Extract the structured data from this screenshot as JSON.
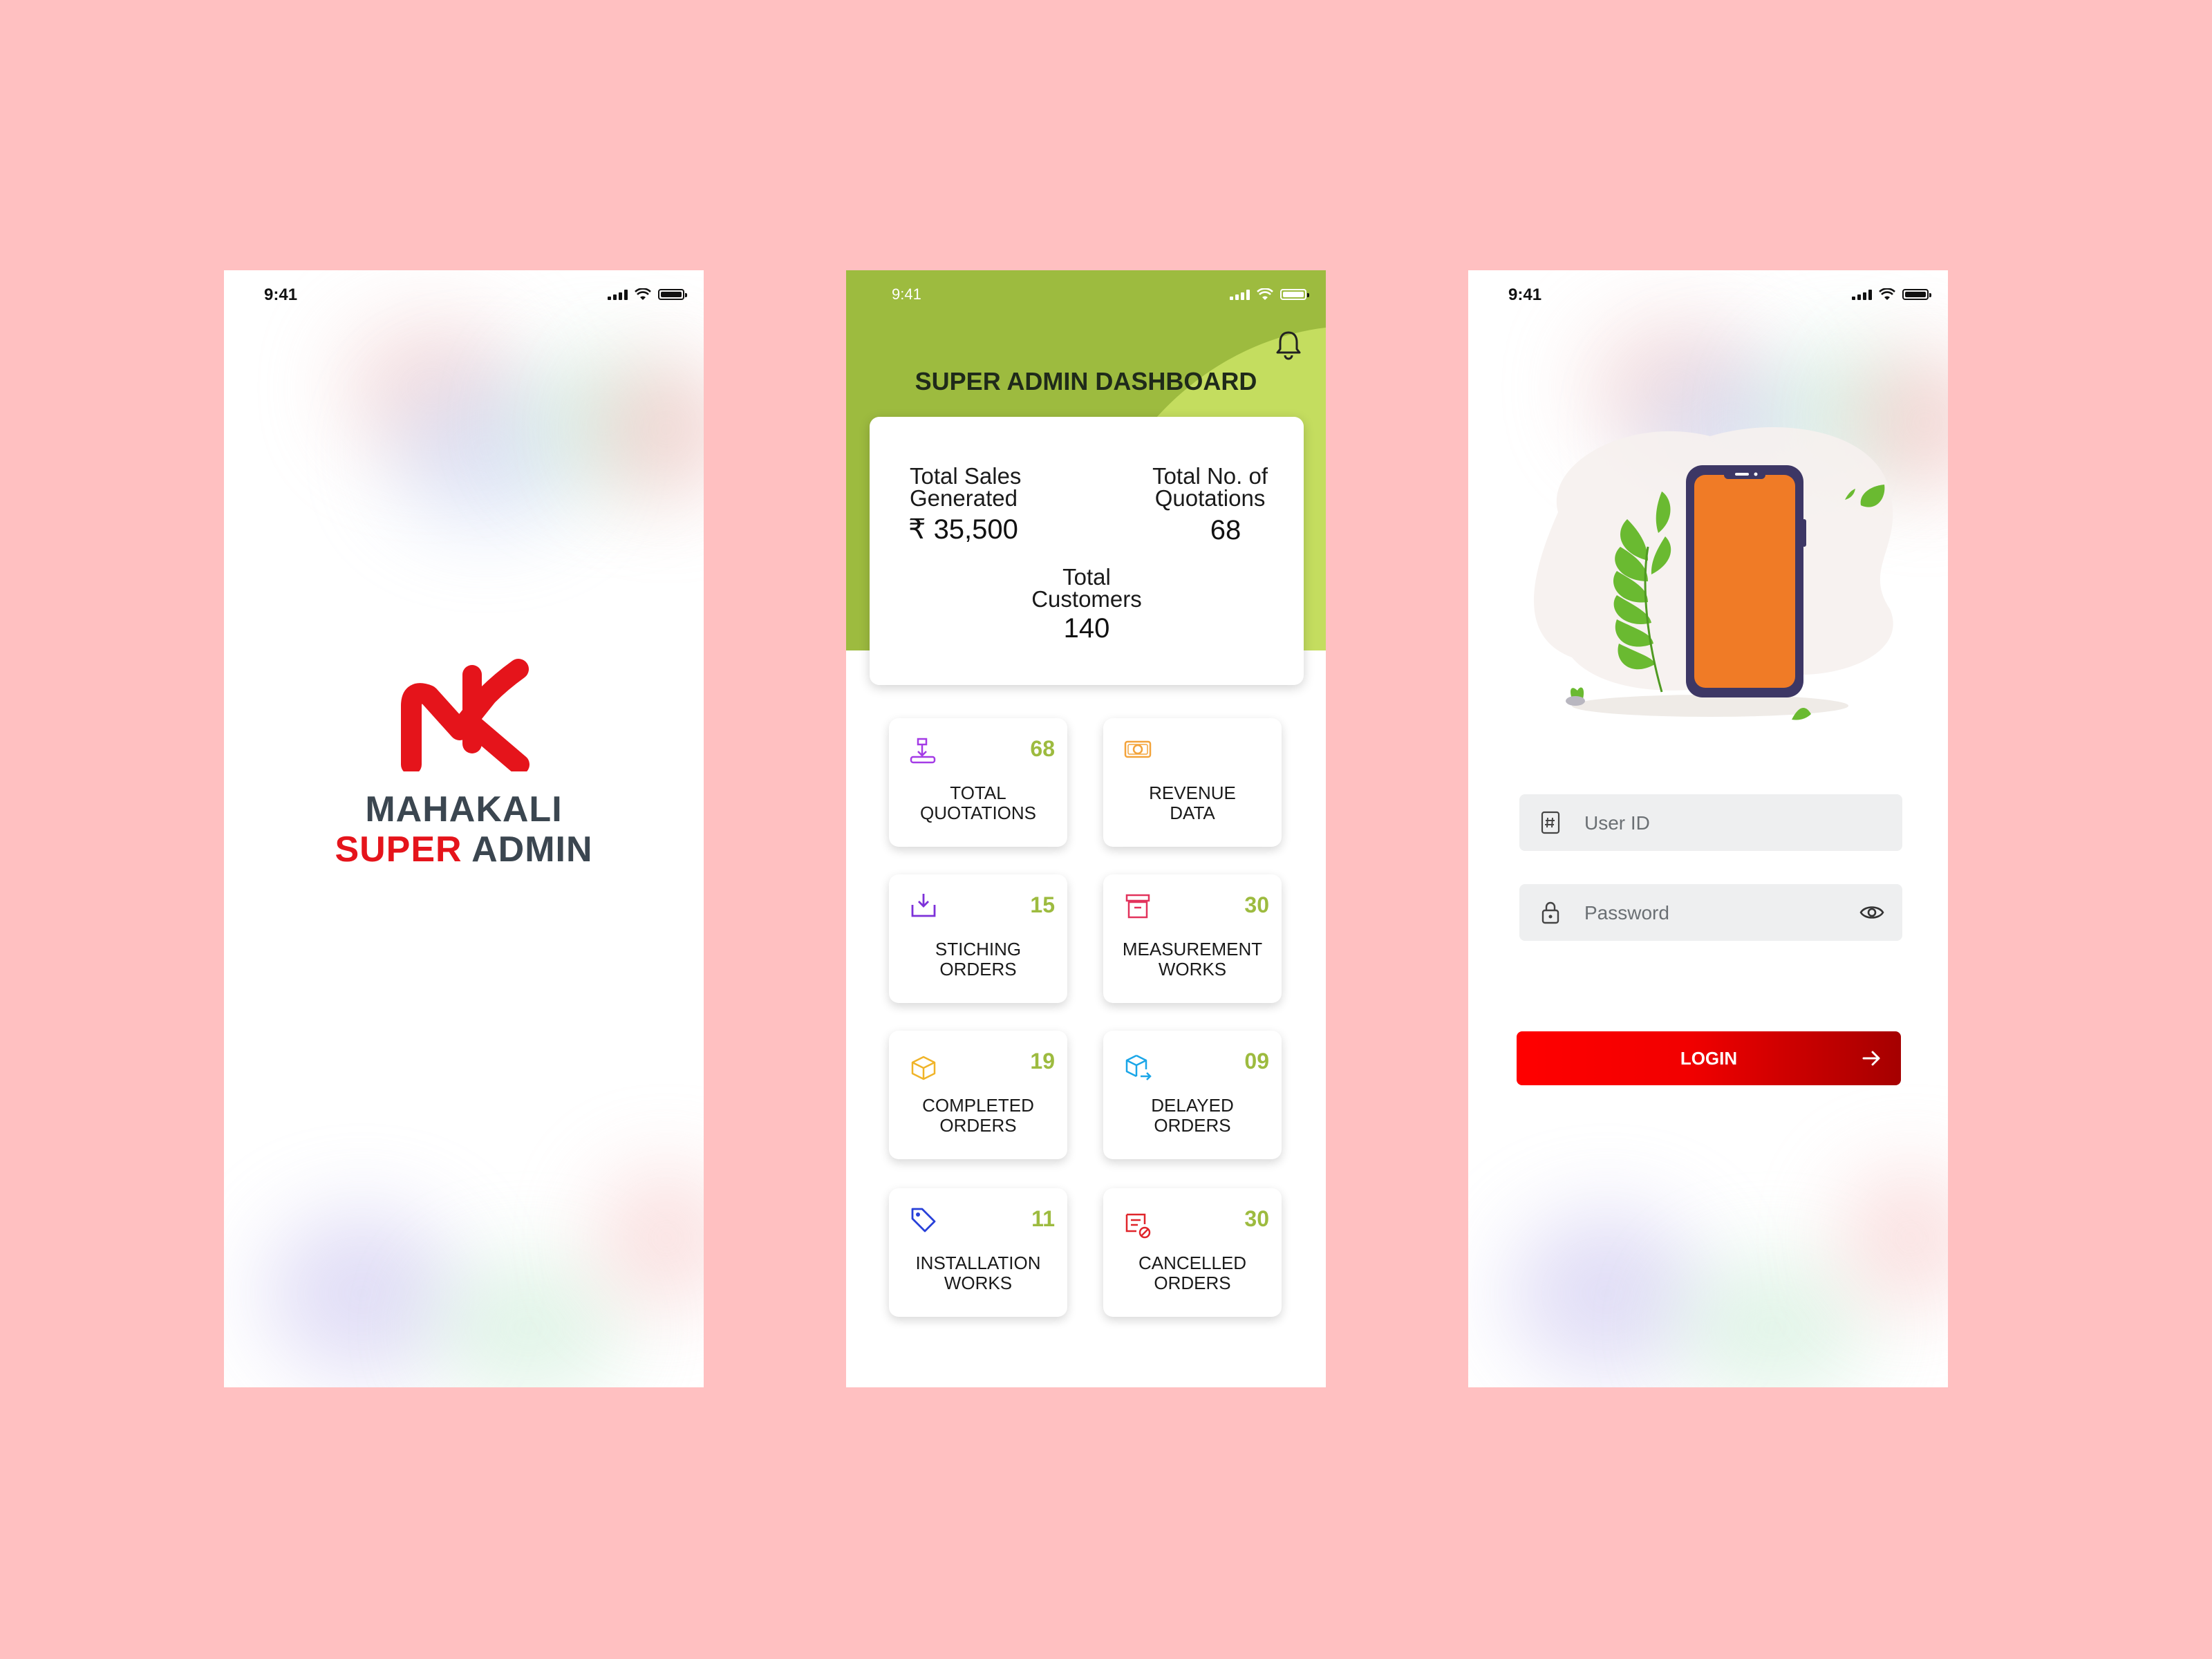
{
  "status_bar": {
    "time": "9:41"
  },
  "splash": {
    "brand_line1": "MAHAKALI",
    "brand_line2_red": "SUPER",
    "brand_line2_dark": "ADMIN"
  },
  "dashboard": {
    "title": "SUPER ADMIN DASHBOARD",
    "summary": {
      "sales_label_line1": "Total Sales",
      "sales_label_line2": "Generated",
      "sales_value": "₹ 35,500",
      "quotations_label_line1": "Total No. of",
      "quotations_label_line2": "Quotations",
      "quotations_value": "68",
      "customers_label_line1": "Total",
      "customers_label_line2": "Customers",
      "customers_value": "140"
    },
    "tiles": [
      {
        "line1": "TOTAL",
        "line2": "QUOTATIONS",
        "count": "68",
        "icon": "quotation-icon",
        "color": "#a43be6"
      },
      {
        "line1": "REVENUE",
        "line2": "DATA",
        "count": "",
        "icon": "money-icon",
        "color": "#f3a33a"
      },
      {
        "line1": "STICHING",
        "line2": "ORDERS",
        "count": "15",
        "icon": "download-box-icon",
        "color": "#7d31d9"
      },
      {
        "line1": "MEASUREMENT",
        "line2": "WORKS",
        "count": "30",
        "icon": "archive-icon",
        "color": "#e2335c"
      },
      {
        "line1": "COMPLETED",
        "line2": "ORDERS",
        "count": "19",
        "icon": "package-icon",
        "color": "#f0b429"
      },
      {
        "line1": "DELAYED",
        "line2": "ORDERS",
        "count": "09",
        "icon": "box-arrow-icon",
        "color": "#1aa6e8"
      },
      {
        "line1": "INSTALLATION",
        "line2": "WORKS",
        "count": "11",
        "icon": "tag-icon",
        "color": "#2740d9"
      },
      {
        "line1": "CANCELLED",
        "line2": "ORDERS",
        "count": "30",
        "icon": "cancel-doc-icon",
        "color": "#e0252b"
      }
    ],
    "accent_color": "#9dbb3f"
  },
  "login": {
    "user_id_placeholder": "User ID",
    "password_placeholder": "Password",
    "login_label": "LOGIN"
  }
}
